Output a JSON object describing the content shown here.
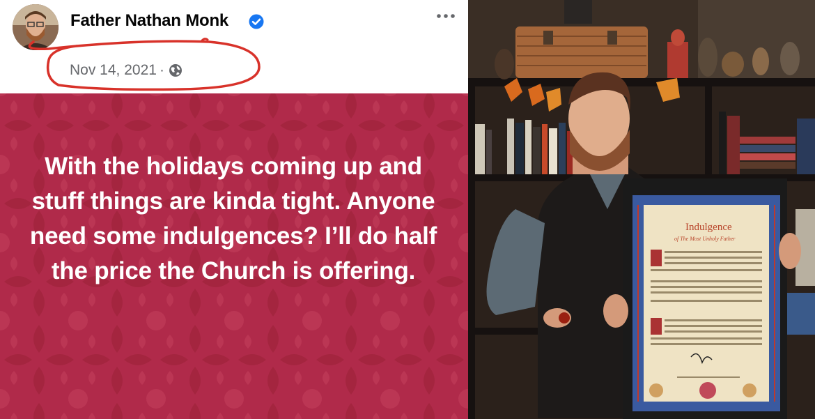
{
  "post": {
    "author": "Father Nathan Monk",
    "date": "Nov 14, 2021",
    "separator": "·",
    "privacy_icon": "globe-icon",
    "verified_icon": "verified-badge-icon",
    "more_icon": "more-options-icon",
    "text": "With the holidays coming up and stuff things are kinda tight. Anyone need some indulgences? I’ll do half the price the Church is offering.",
    "background_color": "#b02a4a",
    "annotation_color": "#d8322a"
  },
  "photo": {
    "document_title": "Indulgence",
    "document_subtitle": "of The Most Unholy Father"
  }
}
